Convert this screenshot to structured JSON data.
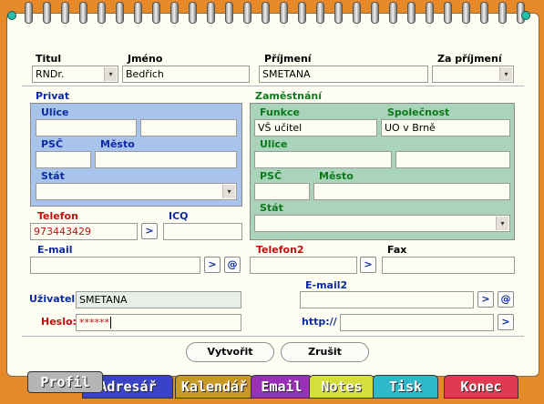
{
  "form": {
    "titul_label": "Titul",
    "titul_value": "RNDr.",
    "jmeno_label": "Jméno",
    "jmeno_value": "Bedřich",
    "prijmeni_label": "Příjmení",
    "prijmeni_value": "SMETANA",
    "za_prijmeni_label": "Za příjmení",
    "za_prijmeni_value": ""
  },
  "privat": {
    "title": "Privat",
    "ulice_label": "Ulice",
    "ulice_value1": "",
    "ulice_value2": "",
    "psc_label": "PSČ",
    "psc_value": "",
    "mesto_label": "Město",
    "mesto_value": "",
    "stat_label": "Stát",
    "stat_value": "",
    "telefon_label": "Telefon",
    "telefon_value": "973443429",
    "icq_label": "ICQ",
    "icq_value": "",
    "email_label": "E-mail",
    "email_value": ""
  },
  "zamestnani": {
    "title": "Zaměstnání",
    "funkce_label": "Funkce",
    "funkce_value": "VŠ učitel",
    "spolecnost_label": "Společnost",
    "spolecnost_value": "UO v Brně",
    "ulice_label": "Ulice",
    "ulice_value1": "",
    "ulice_value2": "",
    "psc_label": "PSČ",
    "psc_value": "",
    "mesto_label": "Město",
    "mesto_value": "",
    "stat_label": "Stát",
    "stat_value": "",
    "telefon2_label": "Telefon2",
    "telefon2_value": "",
    "fax_label": "Fax",
    "fax_value": ""
  },
  "account": {
    "uzivatel_label": "Uživatel:",
    "uzivatel_value": "SMETANA",
    "heslo_label": "Heslo:",
    "heslo_value": "******",
    "email2_label": "E-mail2",
    "email2_value": "",
    "http_label": "http://",
    "http_value": ""
  },
  "buttons": {
    "go_symbol": ">",
    "at_symbol": "@",
    "dropdown_symbol": "▾",
    "create": "Vytvořit",
    "cancel": "Zrušit"
  },
  "tabs": [
    {
      "label": "Profil",
      "color": "#b5b5b5"
    },
    {
      "label": "Adresář",
      "color": "#3a43c6"
    },
    {
      "label": "Kalendář",
      "color": "#c79a28"
    },
    {
      "label": "Email",
      "color": "#9a2fb8"
    },
    {
      "label": "Notes",
      "color": "#d6de3e"
    },
    {
      "label": "Tisk",
      "color": "#2fb8c8"
    },
    {
      "label": "Konec",
      "color": "#e03a52"
    }
  ],
  "colors": {
    "frame": "#e58a2a",
    "paper": "#fefdf2",
    "privat_panel": "#a9c4ea",
    "zamestnani_panel": "#a9d4b9",
    "ring_ends": "#22c0a8"
  }
}
